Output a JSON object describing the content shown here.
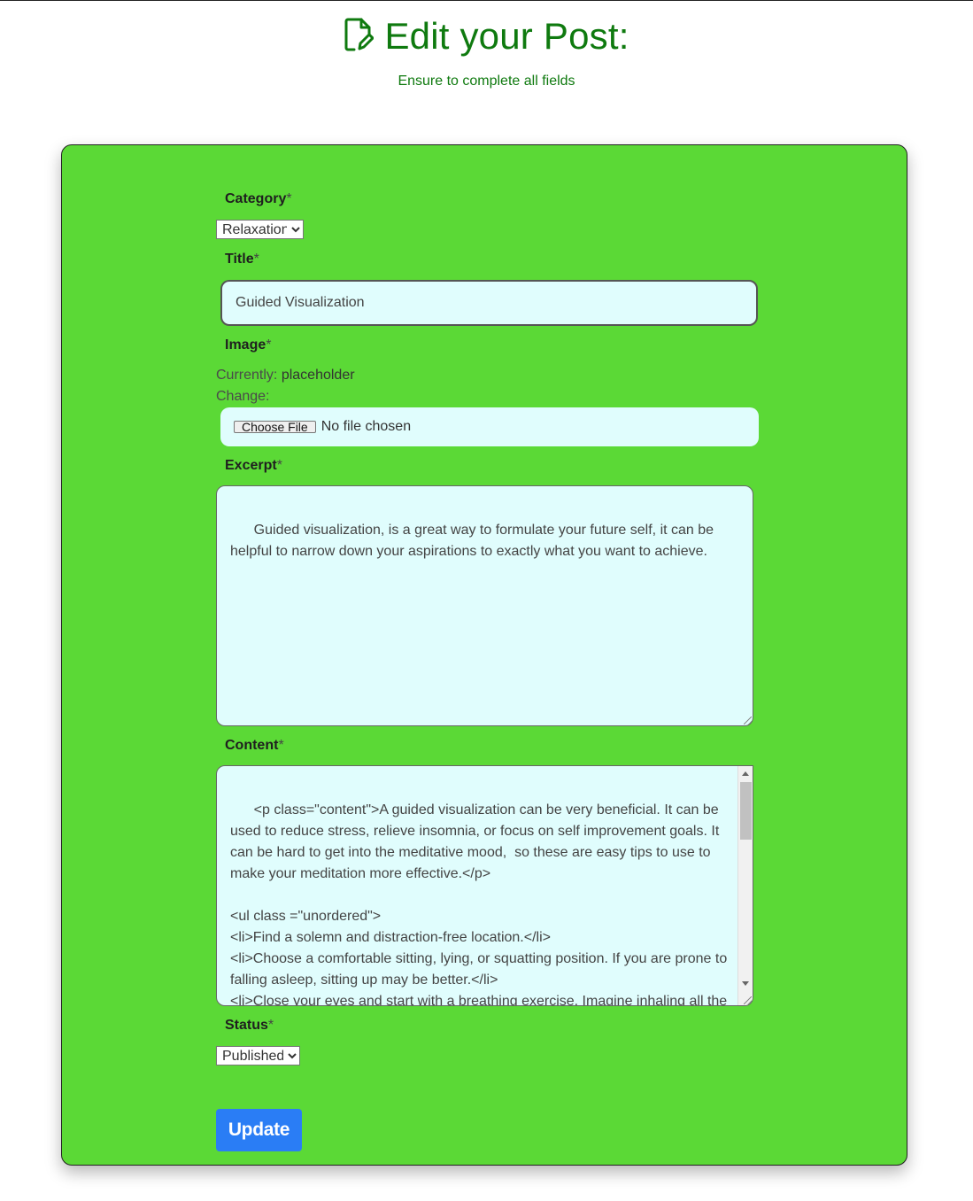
{
  "header": {
    "title": "Edit your Post:",
    "subtitle": "Ensure to complete all fields",
    "icon": "file-edit-icon"
  },
  "form": {
    "category": {
      "label": "Category",
      "required_mark": "*",
      "selected": "Relaxation"
    },
    "title": {
      "label": "Title",
      "required_mark": "*",
      "value": "Guided Visualization"
    },
    "image": {
      "label": "Image",
      "required_mark": "*",
      "currently_label": "Currently:",
      "currently_value": "placeholder",
      "change_label": "Change:",
      "file_button": "Choose File",
      "file_status": "No file chosen"
    },
    "excerpt": {
      "label": "Excerpt",
      "required_mark": "*",
      "value": "Guided visualization, is a great way to formulate your future self, it can be helpful to narrow down your aspirations to exactly what you want to achieve."
    },
    "content": {
      "label": "Content",
      "required_mark": "*",
      "value": "<p class=\"content\">A guided visualization can be very beneficial. It can be used to reduce stress, relieve insomnia, or focus on self improvement goals. It can be hard to get into the meditative mood,  so these are easy tips to use to make your meditation more effective.</p>\n\n<ul class =\"unordered\">\n<li>Find a solemn and distraction-free location.</li>\n<li>Choose a comfortable sitting, lying, or squatting position. If you are prone to falling asleep, sitting up may be better.</li>\n<li>Close your eyes and start with a breathing exercise. Imagine inhaling all the positive energy while exhaling all the negative ones. Continue until you can feel"
    },
    "status": {
      "label": "Status",
      "required_mark": "*",
      "selected": "Published"
    },
    "submit_label": "Update"
  },
  "colors": {
    "heading": "#0f7a0f",
    "card_bg": "#5bd936",
    "field_bg": "#e0fdfd",
    "button": "#2a7df5"
  }
}
